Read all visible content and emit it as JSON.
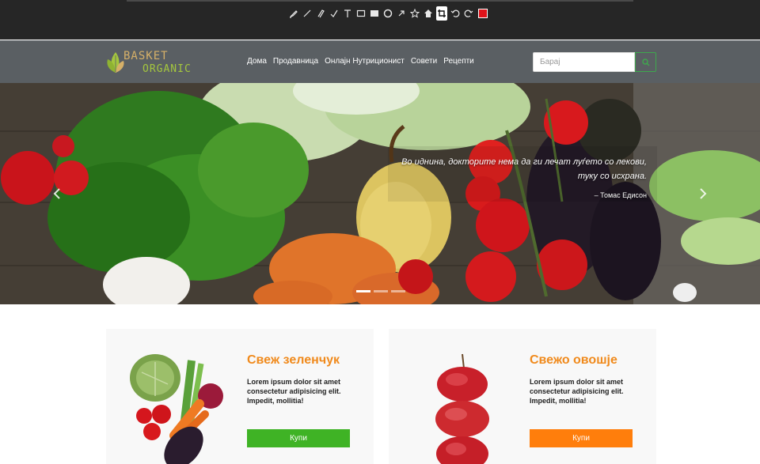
{
  "toolbar": {
    "tools": [
      "pen-icon",
      "line-icon",
      "marker-icon",
      "highlighter-icon",
      "text-icon",
      "rectangle-icon",
      "filled-rectangle-icon",
      "circle-icon",
      "arrow-icon",
      "star-icon",
      "stamp-icon",
      "crop-icon",
      "undo-icon",
      "redo-icon"
    ],
    "active_tool": "crop-icon",
    "color": "#e0141b"
  },
  "navbar": {
    "logo_line1": "BASKET",
    "logo_line2": "ORGANIC",
    "links": [
      "Дома",
      "Продавница",
      "Онлајн Нутриционист",
      "Совети",
      "Рецепти"
    ],
    "search_placeholder": "Барај"
  },
  "hero": {
    "quote_line1": "Во иднина, докторите нема да ги лечат луѓето со лекови,",
    "quote_line2": "туку со исхрана.",
    "quote_author": "– Томас Едисон",
    "active_slide": 1,
    "slide_count": 3
  },
  "products": [
    {
      "title": "Свеж зеленчук",
      "text": "Lorem ipsum dolor sit amet consectetur adipisicing elit. Impedit, mollitia!",
      "button": "Купи",
      "button_color": "#3fb325"
    },
    {
      "title": "Свежо овошје",
      "text": "Lorem ipsum dolor sit amet consectetur adipisicing elit. Impedit, mollitia!",
      "button": "Купи",
      "button_color": "#ff7e0c"
    }
  ]
}
